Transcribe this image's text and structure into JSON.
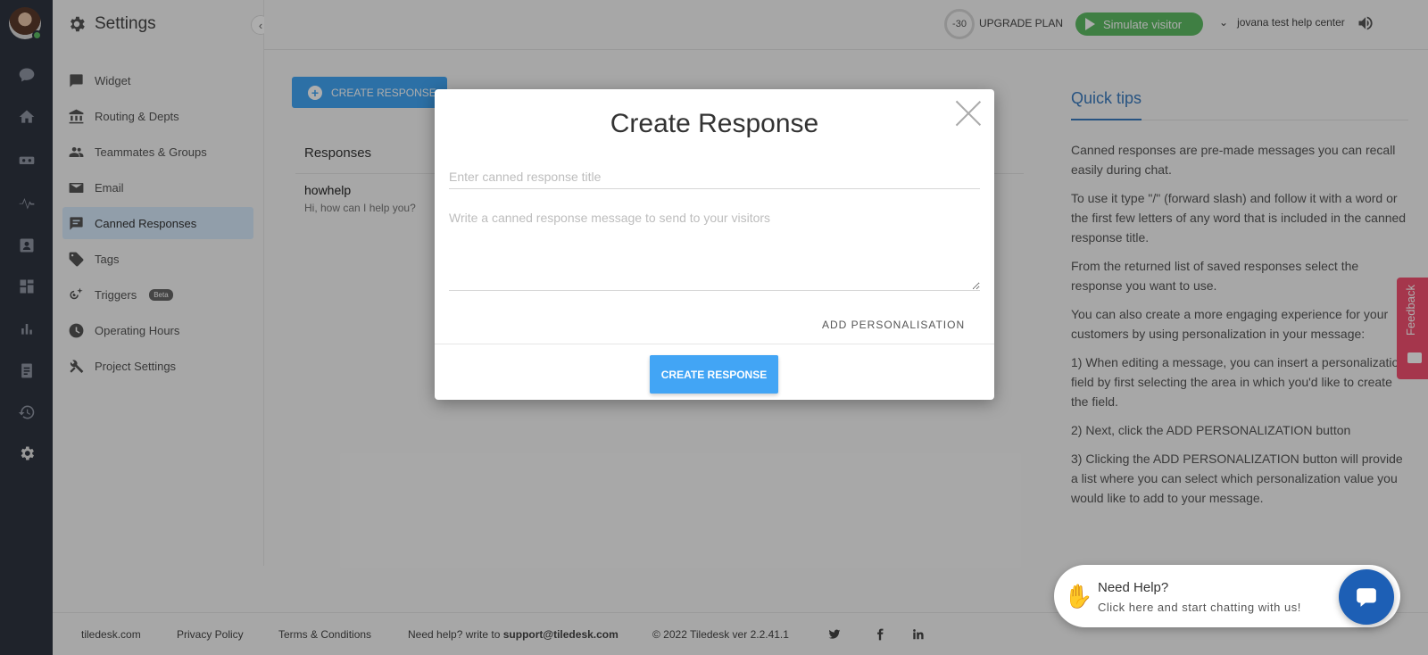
{
  "header": {
    "settings_title": "Settings",
    "quota": "-30",
    "upgrade": "UPGRADE PLAN",
    "simulate": "Simulate visitor",
    "project": "jovana test help center"
  },
  "sidebar": {
    "items": [
      {
        "label": "Widget",
        "icon": "chat-box-icon"
      },
      {
        "label": "Routing & Depts",
        "icon": "bank-icon"
      },
      {
        "label": "Teammates & Groups",
        "icon": "people-icon"
      },
      {
        "label": "Email",
        "icon": "mail-icon"
      },
      {
        "label": "Canned Responses",
        "icon": "canned-icon",
        "active": true
      },
      {
        "label": "Tags",
        "icon": "tag-icon"
      },
      {
        "label": "Triggers",
        "icon": "trigger-icon",
        "badge": "Beta"
      },
      {
        "label": "Operating Hours",
        "icon": "clock-icon"
      },
      {
        "label": "Project Settings",
        "icon": "tools-icon"
      }
    ]
  },
  "main": {
    "create_button": "CREATE RESPONSE",
    "responses_heading": "Responses",
    "responses": [
      {
        "title": "howhelp",
        "message": "Hi, how can I help you?"
      }
    ]
  },
  "quick_tips": {
    "title": "Quick tips",
    "paragraphs": [
      "Canned responses are pre-made messages you can recall easily during chat.",
      "To use it type \"/\" (forward slash) and follow it with a word or the first few letters of any word that is included in the canned response title.",
      "From the returned list of saved responses select the response you want to use.",
      "You can also create a more engaging experience for your customers by using personalization in your message:",
      "1) When editing a message, you can insert a personalization field by first selecting the area in which you'd like to create the field.",
      "2) Next, click the ADD PERSONALIZATION button",
      "3) Clicking the ADD PERSONALIZATION button will provide a list where you can select which personalization value you would like to add to your message."
    ]
  },
  "modal": {
    "title": "Create Response",
    "title_placeholder": "Enter canned response title",
    "message_placeholder": "Write a canned response message to send to your visitors",
    "personalisation": "ADD PERSONALISATION",
    "submit": "CREATE RESPONSE"
  },
  "feedback": "Feedback",
  "footer": {
    "site": "tiledesk.com",
    "privacy": "Privacy Policy",
    "terms": "Terms & Conditions",
    "help_prefix": "Need help? write to ",
    "help_email": "support@tiledesk.com",
    "copyright": "© 2022 Tiledesk ver 2.2.41.1"
  },
  "chat_widget": {
    "title": "Need Help?",
    "subtitle": "Click here and start chatting with us!"
  },
  "colors": {
    "primary": "#42a5f5",
    "success": "#5dbb63",
    "rail": "#2f3440",
    "feedback": "#f45070",
    "chat": "#1d5fb5"
  }
}
